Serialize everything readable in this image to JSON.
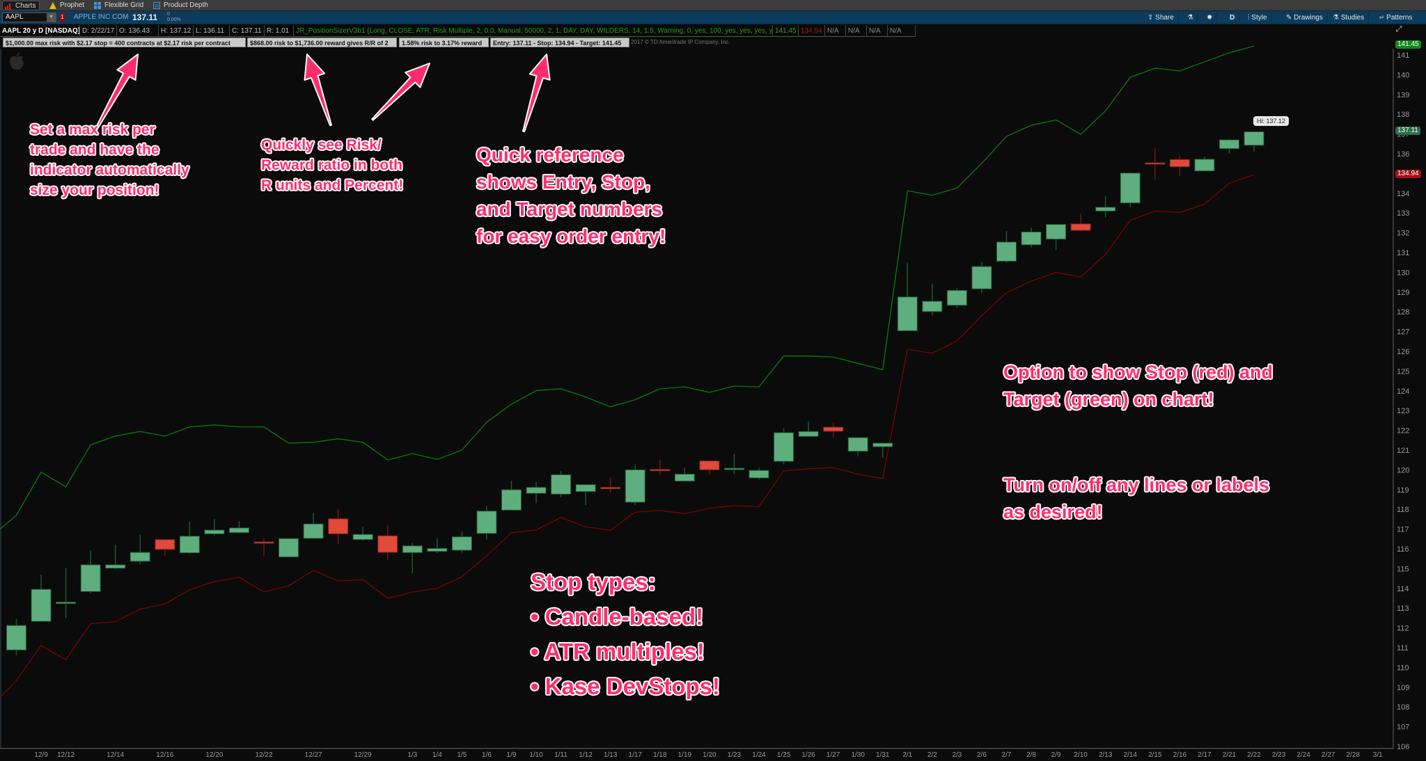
{
  "tabs": [
    {
      "label": "Charts",
      "active": true
    },
    {
      "label": "Prophet"
    },
    {
      "label": "Flexible Grid"
    },
    {
      "label": "Product Depth"
    }
  ],
  "toolbar": {
    "symbol": "AAPL",
    "alert_badge": "1",
    "company": "APPLE INC COM",
    "last": "137.11",
    "change": "0",
    "change_pct": "0.00%",
    "buttons": {
      "share": "Share",
      "period": "D",
      "style": "Style",
      "drawings": "Drawings",
      "studies": "Studies",
      "patterns": "Patterns"
    }
  },
  "infobar": {
    "title": "AAPL 20 y D [NASDAQ]",
    "date": "D:  2/22/17",
    "open": "O:  136.43",
    "high": "H:  137.12",
    "low": "L:  136.11",
    "close": "C:  137.11",
    "range": "R:  1.01",
    "study": "JR_PositionSizerV3b1 (Long, CLOSE, ATR, Risk Multiple, 2, 0.0, Manual, 50000, 2, 1, DAY, DAY, WILDERS, 14, 1.5, Warning, 0, yes, 100, yes, yes, yes, yes, yes, yes, yes)",
    "target": "141.45",
    "stop": "134.94",
    "na": [
      "N/A",
      "N/A",
      "N/A",
      "N/A"
    ]
  },
  "labels": [
    "$1,000.00 max risk with $2.17 stop = 400 contracts at $2.17 risk per contract",
    "$868.00 risk to $1,736.00 reward gives R/R of 2",
    "1.58% risk to 3.17% reward",
    "Entry: 137.11 - Stop: 134.94 - Target: 141.45"
  ],
  "copyright": "2017 © TD Ameritrade IP Company, Inc.",
  "badges": {
    "target": "141.45",
    "last": "137.11",
    "stop": "134.94",
    "hi_bubble": "Hi: 137.12"
  },
  "colors": {
    "annotation": "#ff2d6d",
    "up": "#5fae7e",
    "down": "#e04a3a",
    "target_line": "#0c7a0c",
    "stop_line": "#7a0303",
    "toolbar": "#0b3b5d"
  },
  "annotations": {
    "max_risk": [
      "Set a max risk per",
      "trade and have the",
      "indicator automatically",
      "size your position!"
    ],
    "risk_reward": [
      "Quickly see Risk/",
      "Reward ratio in both",
      "R units and Percent!"
    ],
    "quick_ref": [
      "Quick reference",
      "shows Entry, Stop,",
      "and Target numbers",
      "for easy order entry!"
    ],
    "option": [
      "Option to show Stop (red) and",
      "Target (green) on chart!"
    ],
    "toggle": [
      "Turn on/off any lines or labels",
      "as desired!"
    ],
    "stop_types": [
      "Stop types:",
      "• Candle-based!",
      "• ATR multiples!",
      "• Kase DevStops!"
    ]
  },
  "chart_data": {
    "type": "candlestick",
    "title": "",
    "ylim": [
      106,
      141
    ],
    "yticks": [
      106,
      107,
      108,
      109,
      110,
      111,
      112,
      113,
      114,
      115,
      116,
      117,
      118,
      119,
      120,
      121,
      122,
      123,
      124,
      125,
      126,
      127,
      128,
      129,
      130,
      131,
      132,
      133,
      134,
      135,
      136,
      137,
      138,
      139,
      140,
      141
    ],
    "dates": [
      "12/8",
      "12/9",
      "12/12",
      "12/13",
      "12/14",
      "12/15",
      "12/16",
      "12/19",
      "12/20",
      "12/21",
      "12/22",
      "12/23",
      "12/27",
      "12/28",
      "12/29",
      "12/30",
      "1/3",
      "1/4",
      "1/5",
      "1/6",
      "1/9",
      "1/10",
      "1/11",
      "1/12",
      "1/13",
      "1/17",
      "1/18",
      "1/19",
      "1/20",
      "1/23",
      "1/24",
      "1/25",
      "1/26",
      "1/27",
      "1/30",
      "1/31",
      "2/1",
      "2/2",
      "2/3",
      "2/6",
      "2/7",
      "2/8",
      "2/9",
      "2/10",
      "2/13",
      "2/14",
      "2/15",
      "2/16",
      "2/17",
      "2/21",
      "2/22",
      "2/23",
      "2/24",
      "2/27",
      "2/28",
      "3/1"
    ],
    "xtick_labels": [
      "12/9",
      "12/12",
      "12/14",
      "12/16",
      "12/20",
      "12/22",
      "12/27",
      "12/29",
      "1/3",
      "1/4",
      "1/5",
      "1/6",
      "1/9",
      "1/10",
      "1/11",
      "1/12",
      "1/13",
      "1/17",
      "1/18",
      "1/19",
      "1/20",
      "1/23",
      "1/24",
      "1/25",
      "1/26",
      "1/27",
      "1/30",
      "1/31",
      "2/1",
      "2/2",
      "2/3",
      "2/6",
      "2/7",
      "2/8",
      "2/9",
      "2/10",
      "2/13",
      "2/14",
      "2/15",
      "2/16",
      "2/17",
      "2/21",
      "2/22",
      "2/23",
      "2/24",
      "2/27",
      "2/28",
      "3/1"
    ],
    "open": [
      110.88,
      112.33,
      113.29,
      113.84,
      115.02,
      115.37,
      116.47,
      115.8,
      116.76,
      116.82,
      116.35,
      115.59,
      116.53,
      117.52,
      116.47,
      116.66,
      115.81,
      115.87,
      115.93,
      116.78,
      117.96,
      118.81,
      118.77,
      118.9,
      119.11,
      118.36,
      120.02,
      119.43,
      120.45,
      120.05,
      119.59,
      120.43,
      121.69,
      122.16,
      120.94,
      121.17,
      127.04,
      128.01,
      128.33,
      129.16,
      130.56,
      131.39,
      131.68,
      132.45,
      133.1,
      133.51,
      135.54,
      135.71,
      135.13,
      136.26,
      136.43
    ],
    "high": [
      112.46,
      114.7,
      115.02,
      115.93,
      116.21,
      116.72,
      116.5,
      117.38,
      117.51,
      117.41,
      116.52,
      116.54,
      117.83,
      118.02,
      117.13,
      117.2,
      116.31,
      116.53,
      116.88,
      118.17,
      119.45,
      119.4,
      119.94,
      119.25,
      119.63,
      120.26,
      120.51,
      120.11,
      120.45,
      120.81,
      120.11,
      122.11,
      122.44,
      122.36,
      121.65,
      121.35,
      130.49,
      129.41,
      129.2,
      130.52,
      132.09,
      132.25,
      132.44,
      132.96,
      133.85,
      135.06,
      136.31,
      135.94,
      135.85,
      136.74,
      137.12
    ],
    "low": [
      110.61,
      112.33,
      112.49,
      113.75,
      114.97,
      115.22,
      115.65,
      115.75,
      116.69,
      116.78,
      115.65,
      115.59,
      116.5,
      116.23,
      116.41,
      115.45,
      114.76,
      115.77,
      115.81,
      116.47,
      117.96,
      118.31,
      118.61,
      118.21,
      118.83,
      118.21,
      119.74,
      119.43,
      119.74,
      119.8,
      119.51,
      120.28,
      121.69,
      121.64,
      120.68,
      120.62,
      127.04,
      127.82,
      128.19,
      128.94,
      130.47,
      131.25,
      131.13,
      132.07,
      132.78,
      133.28,
      134.66,
      134.88,
      135.13,
      136.0,
      136.11
    ],
    "close": [
      112.12,
      113.95,
      113.3,
      115.19,
      115.19,
      115.82,
      115.97,
      116.64,
      116.95,
      117.06,
      116.29,
      116.52,
      117.26,
      116.76,
      116.73,
      115.82,
      116.15,
      116.02,
      116.61,
      117.91,
      118.99,
      119.11,
      119.75,
      119.25,
      119.04,
      120.0,
      119.99,
      119.78,
      120.0,
      120.08,
      119.97,
      121.88,
      121.94,
      121.95,
      121.63,
      121.35,
      128.75,
      128.53,
      129.08,
      130.29,
      131.53,
      132.04,
      132.42,
      132.12,
      133.29,
      135.02,
      135.51,
      135.34,
      135.72,
      136.7,
      137.11
    ],
    "series": [
      {
        "role": "target",
        "values": [
          117.7,
          119.88,
          119.14,
          121.26,
          121.71,
          121.94,
          121.71,
          122.17,
          122.27,
          122.17,
          122.17,
          121.35,
          121.39,
          121.57,
          121.39,
          120.5,
          120.82,
          120.53,
          121.0,
          122.41,
          123.32,
          124.01,
          124.1,
          123.69,
          123.19,
          123.55,
          124.1,
          124.2,
          123.92,
          124.24,
          124.2,
          125.76,
          125.76,
          125.71,
          125.39,
          125.07,
          134.13,
          133.9,
          134.26,
          135.51,
          136.88,
          137.44,
          137.71,
          136.98,
          138.17,
          139.87,
          140.33,
          140.19,
          140.65,
          141.11,
          141.45
        ]
      },
      {
        "role": "stop",
        "values": [
          109.34,
          111.1,
          110.39,
          112.21,
          112.31,
          112.95,
          113.21,
          113.93,
          114.34,
          114.56,
          113.82,
          114.13,
          114.91,
          114.38,
          114.44,
          113.5,
          113.81,
          114.0,
          114.59,
          115.65,
          116.82,
          116.96,
          117.59,
          117.11,
          116.94,
          117.86,
          117.94,
          117.78,
          118.06,
          118.18,
          118.14,
          119.95,
          120.05,
          120.11,
          119.78,
          119.56,
          126.1,
          125.9,
          126.52,
          127.8,
          128.97,
          129.55,
          129.99,
          129.76,
          130.9,
          132.63,
          133.1,
          133.03,
          133.45,
          134.51,
          134.94
        ]
      }
    ],
    "grid": false
  }
}
